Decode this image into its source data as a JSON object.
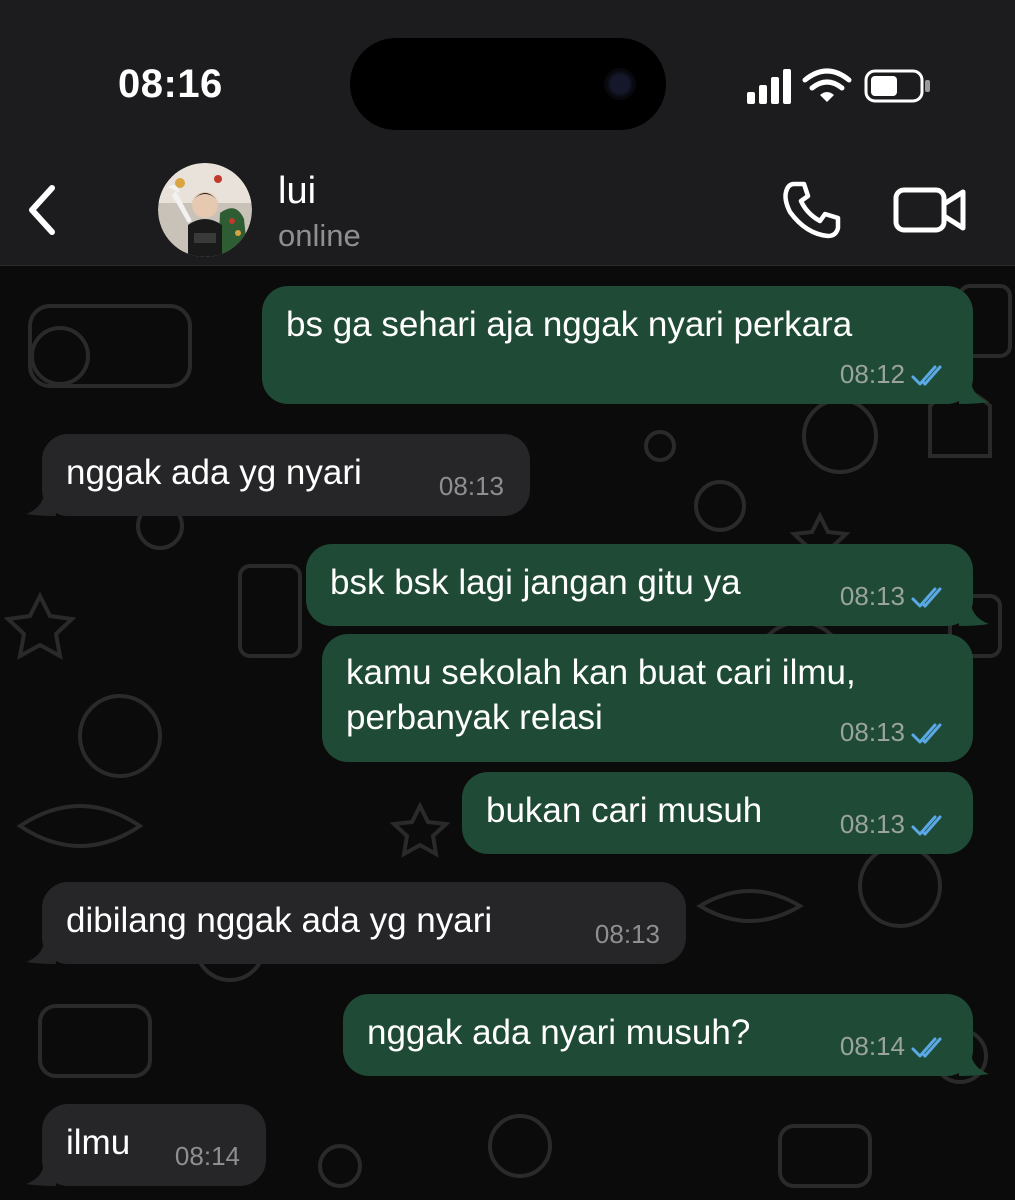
{
  "status_bar": {
    "time": "08:16"
  },
  "header": {
    "contact_name": "lui",
    "contact_status": "online"
  },
  "icons": {
    "back": "chevron-left-icon",
    "call": "phone-icon",
    "video": "video-camera-icon",
    "read_receipt": "double-check-icon"
  },
  "colors": {
    "outgoing_bubble": "#1f4a35",
    "incoming_bubble": "#262628",
    "read_ticks": "#5aa9e6",
    "status_gray": "#8e8e93"
  },
  "messages": [
    {
      "direction": "out",
      "lines": [
        "bs ga sehari aja nggak nyari perkara"
      ],
      "time": "08:12",
      "read": true
    },
    {
      "direction": "in",
      "lines": [
        "nggak ada yg nyari"
      ],
      "time": "08:13"
    },
    {
      "direction": "out",
      "lines": [
        "bsk bsk lagi jangan gitu ya"
      ],
      "time": "08:13",
      "read": true
    },
    {
      "direction": "out",
      "lines": [
        "kamu sekolah kan buat cari ilmu,",
        "perbanyak relasi"
      ],
      "time": "08:13",
      "read": true
    },
    {
      "direction": "out",
      "lines": [
        "bukan cari musuh"
      ],
      "time": "08:13",
      "read": true
    },
    {
      "direction": "in",
      "lines": [
        "dibilang nggak ada yg nyari"
      ],
      "time": "08:13"
    },
    {
      "direction": "out",
      "lines": [
        "nggak ada nyari musuh?"
      ],
      "time": "08:14",
      "read": true
    },
    {
      "direction": "in",
      "lines": [
        "ilmu"
      ],
      "time": "08:14"
    }
  ]
}
